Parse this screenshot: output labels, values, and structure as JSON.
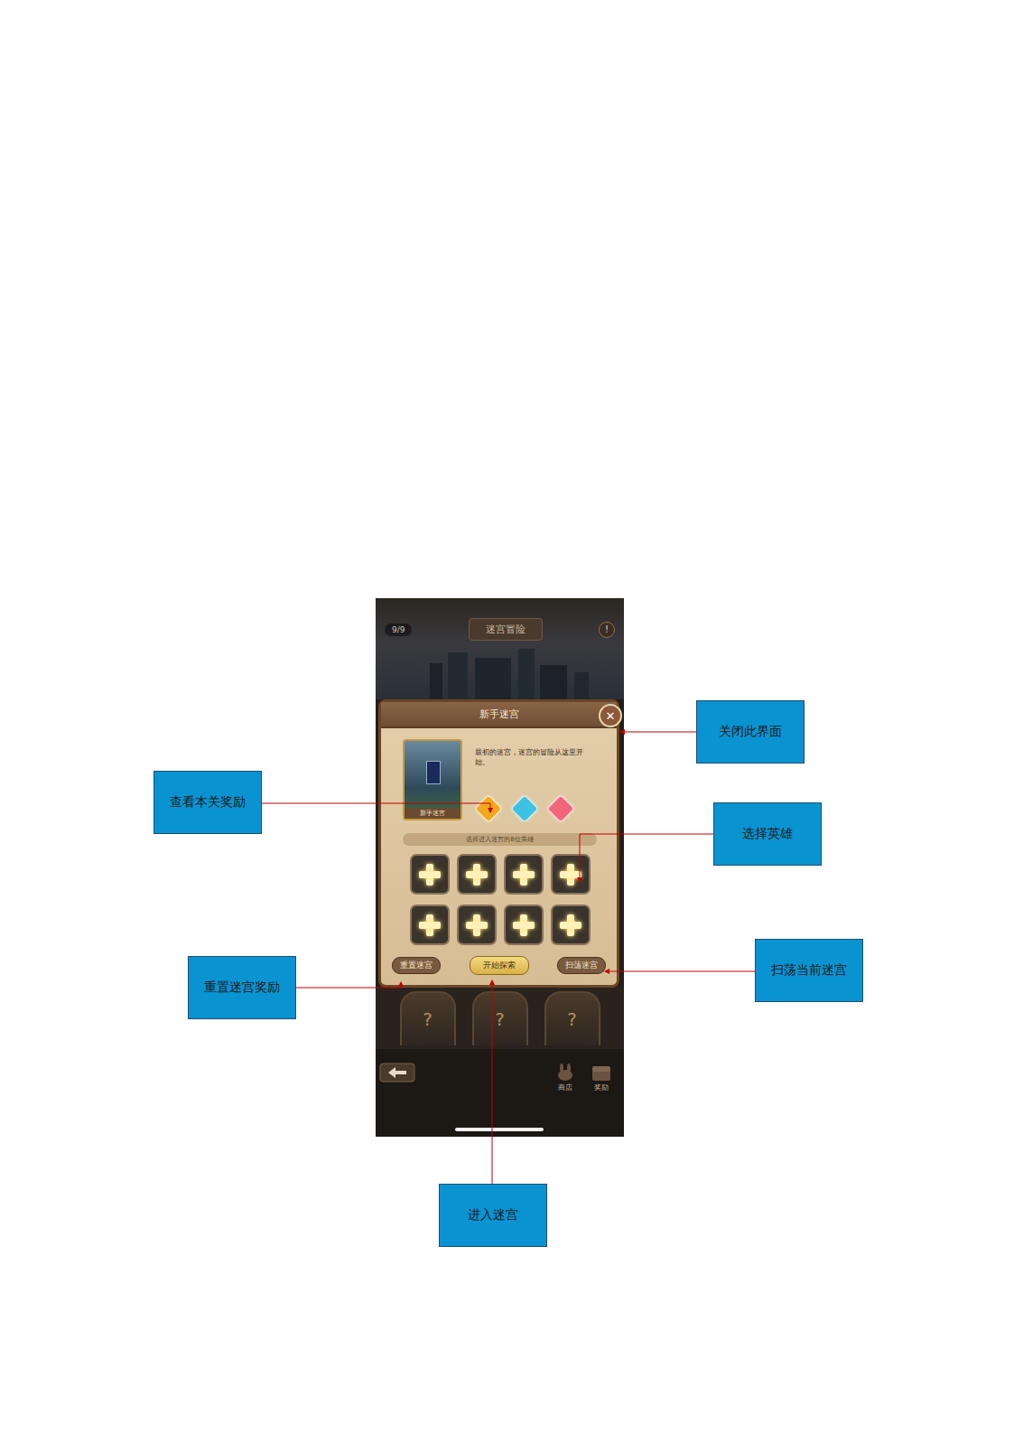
{
  "screenshot": {
    "progress": "9/9",
    "title": "迷宫冒险",
    "info_icon": "!",
    "dialog": {
      "title": "新手迷宫",
      "close_icon": "✕",
      "card_label": "新手迷宫",
      "description": "最初的迷宫，迷宫的冒险从这里开始。",
      "rewards": [
        {
          "color": "#f2a81e"
        },
        {
          "color": "#3ec2e4"
        },
        {
          "color": "#f2667a"
        }
      ],
      "hero_prompt": "选择进入迷宫的8位英雄",
      "hero_slots": [
        {
          "filled": false
        },
        {
          "filled": false
        },
        {
          "filled": false
        },
        {
          "filled": false
        },
        {
          "filled": false
        },
        {
          "filled": false
        },
        {
          "filled": false
        },
        {
          "filled": false
        }
      ],
      "buttons": [
        {
          "label": "重置迷宫",
          "kind": "secondary"
        },
        {
          "label": "开始探索",
          "kind": "primary"
        },
        {
          "label": "扫荡迷宫",
          "kind": "secondary"
        }
      ]
    },
    "doors": [
      {
        "label": "?"
      },
      {
        "label": "?"
      },
      {
        "label": "?"
      }
    ],
    "nav": [
      {
        "label": "商店"
      },
      {
        "label": "奖励"
      }
    ]
  },
  "annotations": [
    {
      "label": "关闭此界面"
    },
    {
      "label": "查看本关奖励"
    },
    {
      "label": "选择英雄"
    },
    {
      "label": "重置迷宫奖励"
    },
    {
      "label": "扫荡当前迷宫"
    },
    {
      "label": "进入迷宫"
    }
  ]
}
